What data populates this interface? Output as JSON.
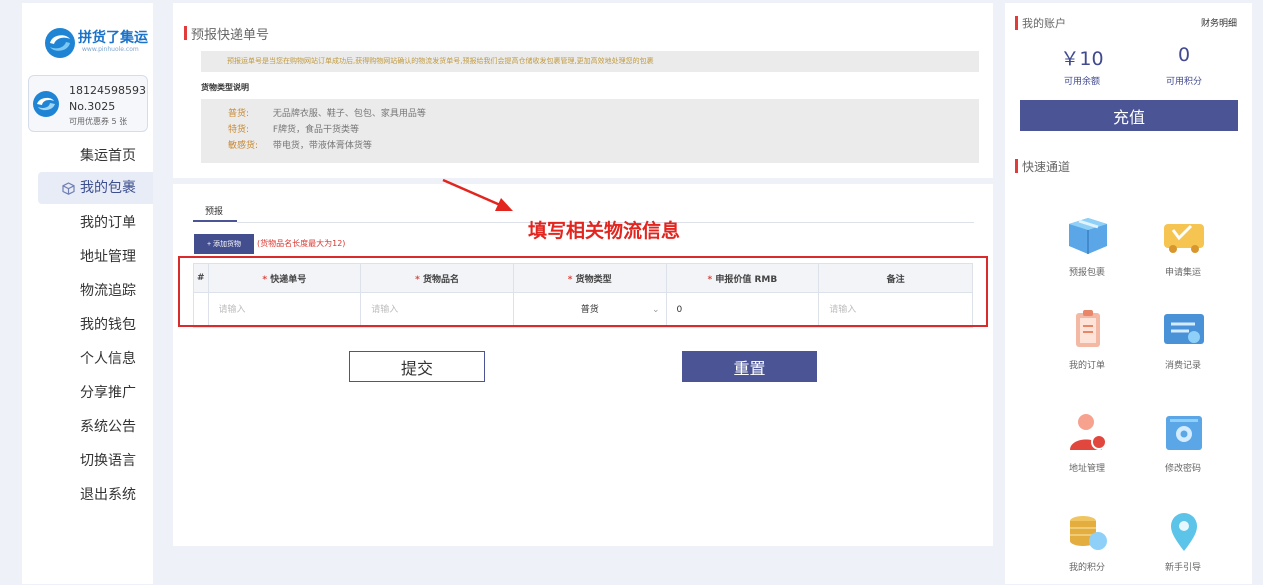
{
  "sidebar": {
    "logo_title": "拼货了集运",
    "logo_url": "www.pinhuole.com",
    "user_phone": "18124598593",
    "user_no": "No.3025",
    "coupon_text": "可用优惠券 5 张",
    "nav": [
      {
        "label": "集运首页"
      },
      {
        "label": "我的包裹"
      },
      {
        "label": "我的订单"
      },
      {
        "label": "地址管理"
      },
      {
        "label": "物流追踪"
      },
      {
        "label": "我的钱包"
      },
      {
        "label": "个人信息"
      },
      {
        "label": "分享推广"
      },
      {
        "label": "系统公告"
      },
      {
        "label": "切换语言"
      },
      {
        "label": "退出系统"
      }
    ]
  },
  "top_panel": {
    "title": "预报快递单号",
    "notice": "预报运单号是当您在购物网站订单成功后,获得购物网站确认的物流发货单号,预报给我们会提高仓储收发包裹管理,更加高效地处理您的包裹",
    "type_caption": "货物类型说明",
    "types": [
      {
        "name": "普货:",
        "desc": "无品牌衣服、鞋子、包包、家具用品等"
      },
      {
        "name": "特货:",
        "desc": "F牌货，食品干货类等"
      },
      {
        "name": "敏感货:",
        "desc": "带电货，带液体膏体货等"
      }
    ]
  },
  "form": {
    "tab_label": "预报",
    "add_button": "+ 添加货物",
    "add_hint": "(货物品名长度最大为12)",
    "annotation": "填写相关物流信息",
    "columns": {
      "index": "#",
      "tracking": "快递单号",
      "name": "货物品名",
      "type": "货物类型",
      "value": "申报价值 RMB",
      "remark": "备注"
    },
    "required_mark": "*",
    "row": {
      "tracking_placeholder": "请输入",
      "name_placeholder": "请输入",
      "type_value": "普货",
      "value_value": "0",
      "remark_placeholder": "请输入"
    },
    "submit_label": "提交",
    "reset_label": "重置"
  },
  "account": {
    "title": "我的账户",
    "finance_link": "财务明细",
    "balance_value": "￥10",
    "balance_label": "可用余额",
    "points_value": "0",
    "points_label": "可用积分",
    "recharge_label": "充值"
  },
  "quick": {
    "title": "快速通道",
    "items": [
      {
        "label": "预报包裹",
        "icon": "package-box-icon"
      },
      {
        "label": "申请集运",
        "icon": "delivery-truck-icon"
      },
      {
        "label": "我的订单",
        "icon": "clipboard-icon"
      },
      {
        "label": "消费记录",
        "icon": "monitor-record-icon"
      },
      {
        "label": "地址管理",
        "icon": "user-address-icon"
      },
      {
        "label": "修改密码",
        "icon": "password-gear-icon"
      },
      {
        "label": "我的积分",
        "icon": "coins-stack-icon"
      },
      {
        "label": "新手引导",
        "icon": "location-pin-icon"
      }
    ]
  },
  "colors": {
    "accent": "#4b5596",
    "highlight_red": "#d92b2b",
    "background": "#eef1f8"
  }
}
